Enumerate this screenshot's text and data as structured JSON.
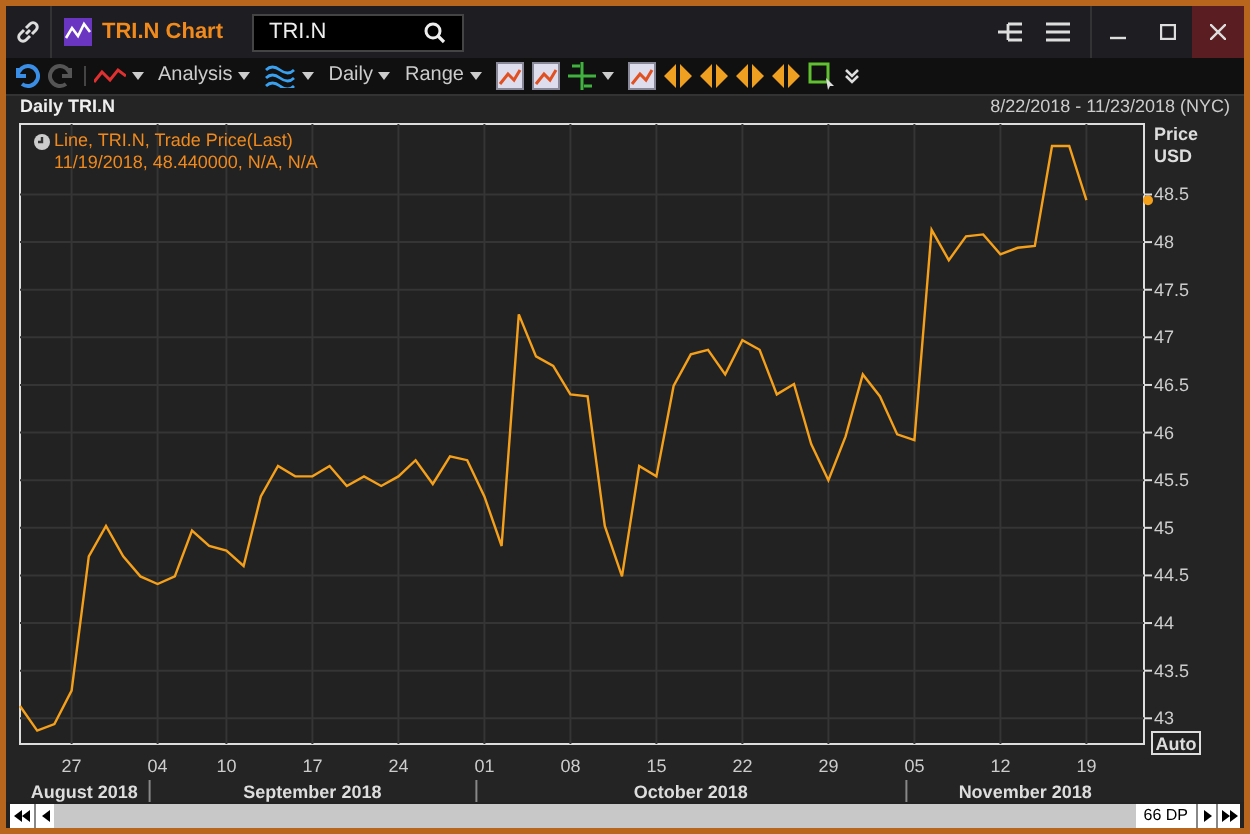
{
  "window": {
    "title": "TRI.N Chart"
  },
  "search": {
    "value": "TRI.N"
  },
  "toolbar": [
    {
      "kind": "undo"
    },
    {
      "kind": "redo"
    },
    {
      "kind": "linestyle"
    },
    {
      "kind": "menu",
      "label": "Analysis"
    },
    {
      "kind": "waves"
    },
    {
      "kind": "menu",
      "label": "Daily"
    },
    {
      "kind": "menu",
      "label": "Range"
    },
    {
      "kind": "tool"
    },
    {
      "kind": "tool"
    },
    {
      "kind": "crosshair"
    },
    {
      "kind": "tool"
    },
    {
      "kind": "arrows"
    },
    {
      "kind": "arrows"
    },
    {
      "kind": "arrows"
    },
    {
      "kind": "arrows"
    },
    {
      "kind": "select"
    },
    {
      "kind": "more"
    }
  ],
  "panel": {
    "title": "Daily TRI.N",
    "range": "8/22/2018 - 11/23/2018 (NYC)"
  },
  "legend": {
    "line1": "Line, TRI.N, Trade Price(Last)",
    "line2": "11/19/2018, 48.440000, N/A, N/A"
  },
  "axis": {
    "title1": "Price",
    "title2": "USD",
    "auto": "Auto",
    "days": [
      "27",
      "04",
      "10",
      "17",
      "24",
      "01",
      "08",
      "15",
      "22",
      "29",
      "05",
      "12",
      "19"
    ],
    "months": [
      "August 2018",
      "September 2018",
      "October 2018",
      "November 2018"
    ]
  },
  "chart_data": {
    "type": "line",
    "grid": true,
    "ylim": [
      42.73,
      49.24
    ],
    "yticks": [
      43,
      43.5,
      44,
      44.5,
      45,
      45.5,
      46,
      46.5,
      47,
      47.5,
      48,
      48.5
    ],
    "series": [
      {
        "color": "#f5a01a",
        "values": [
          43.13,
          42.87,
          42.94,
          43.29,
          44.7,
          45.02,
          44.7,
          44.49,
          44.41,
          44.49,
          44.97,
          44.81,
          44.76,
          44.6,
          45.33,
          45.65,
          45.54,
          45.54,
          45.65,
          45.44,
          45.54,
          45.44,
          45.54,
          45.71,
          45.46,
          45.75,
          45.71,
          45.33,
          44.81,
          47.24,
          46.8,
          46.7,
          46.4,
          46.38,
          45.02,
          44.49,
          45.65,
          45.54,
          46.49,
          46.82,
          46.87,
          46.61,
          46.97,
          46.87,
          46.4,
          46.51,
          45.88,
          45.5,
          45.96,
          46.61,
          46.38,
          45.98,
          45.92,
          48.13,
          47.81,
          48.06,
          48.08,
          47.87,
          47.94,
          47.96,
          49.01,
          49.01,
          48.44,
          null,
          null,
          null
        ]
      }
    ]
  },
  "scrollbar": {
    "count": "66 DP"
  }
}
